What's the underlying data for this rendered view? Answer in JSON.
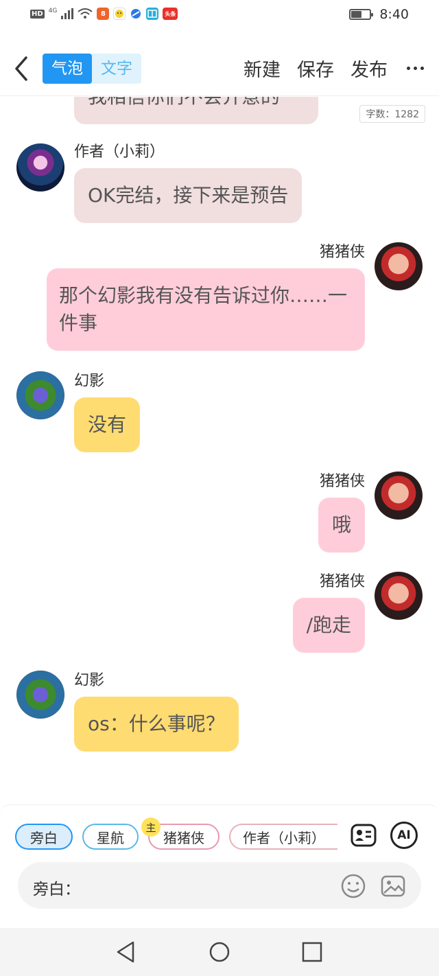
{
  "status_bar": {
    "network": "HD",
    "network_type": "4G",
    "time": "8:40",
    "battery_level": 0.55,
    "app_icons": [
      "taobao-icon",
      "lemon-icon",
      "browser-icon",
      "reader-icon",
      "toutiao-icon"
    ]
  },
  "header": {
    "tab_bubble": "气泡",
    "tab_text": "文字",
    "new_label": "新建",
    "save_label": "保存",
    "publish_label": "发布"
  },
  "chat": {
    "word_count": "字数：1282",
    "partial_message": "我相信你们不会介意的",
    "messages": [
      {
        "speaker": "作者（小莉）",
        "side": "left",
        "text": "OK完结，接下来是预告"
      },
      {
        "speaker": "猪猪侠",
        "side": "right",
        "text": "那个幻影我有没有告诉过你……一件事"
      },
      {
        "speaker": "幻影",
        "side": "left",
        "text": "没有"
      },
      {
        "speaker": "猪猪侠",
        "side": "right",
        "text": "哦"
      },
      {
        "speaker": "猪猪侠",
        "side": "right",
        "text": "/跑走"
      },
      {
        "speaker": "幻影",
        "side": "left",
        "text": "os：什么事呢？"
      }
    ]
  },
  "composer": {
    "chips": [
      "旁白",
      "星航",
      "猪猪侠",
      "作者（小莉）"
    ],
    "main_badge": "主",
    "ai_label": "AI",
    "input_label": "旁白："
  },
  "colors": {
    "accent": "#2196f3",
    "author_bubble": "#f1dede",
    "pig_bubble": "#ffcdd9",
    "phantom_bubble": "#ffdc71"
  }
}
